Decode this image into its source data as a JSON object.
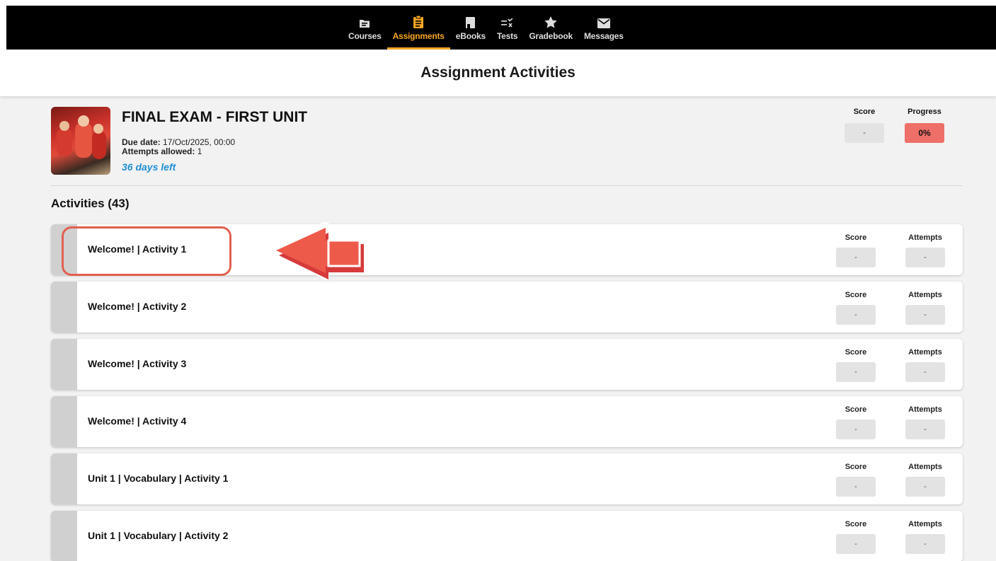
{
  "nav": {
    "items": [
      {
        "label": "Courses",
        "icon": "folder-icon",
        "active": false
      },
      {
        "label": "Assignments",
        "icon": "clipboard-icon",
        "active": true
      },
      {
        "label": "eBooks",
        "icon": "book-icon",
        "active": false
      },
      {
        "label": "Tests",
        "icon": "checklist-icon",
        "active": false
      },
      {
        "label": "Gradebook",
        "icon": "star-icon",
        "active": false
      },
      {
        "label": "Messages",
        "icon": "envelope-icon",
        "active": false
      }
    ],
    "active_color": "#f6a623"
  },
  "page": {
    "title": "Assignment Activities"
  },
  "assignment": {
    "title": "FINAL EXAM - FIRST UNIT",
    "due_label": "Due date:",
    "due_value": "17/Oct/2025, 00:00",
    "attempts_label": "Attempts allowed:",
    "attempts_value": "1",
    "days_left": "36 days left",
    "score_label": "Score",
    "score_value": "-",
    "progress_label": "Progress",
    "progress_value": "0%",
    "progress_color": "#ee6f67"
  },
  "activities": {
    "header": "Activities (43)",
    "score_label": "Score",
    "attempts_label": "Attempts",
    "items": [
      {
        "title": "Welcome! | Activity 1",
        "score": "-",
        "attempts": "-"
      },
      {
        "title": "Welcome! | Activity 2",
        "score": "-",
        "attempts": "-"
      },
      {
        "title": "Welcome! | Activity 3",
        "score": "-",
        "attempts": "-"
      },
      {
        "title": "Welcome! | Activity 4",
        "score": "-",
        "attempts": "-"
      },
      {
        "title": "Unit 1 | Vocabulary | Activity 1",
        "score": "-",
        "attempts": "-"
      },
      {
        "title": "Unit 1 | Vocabulary | Activity 2",
        "score": "-",
        "attempts": "-"
      }
    ]
  },
  "annotation": {
    "highlight_color": "#e0604f",
    "arrow_color": "#ee5a4a"
  }
}
